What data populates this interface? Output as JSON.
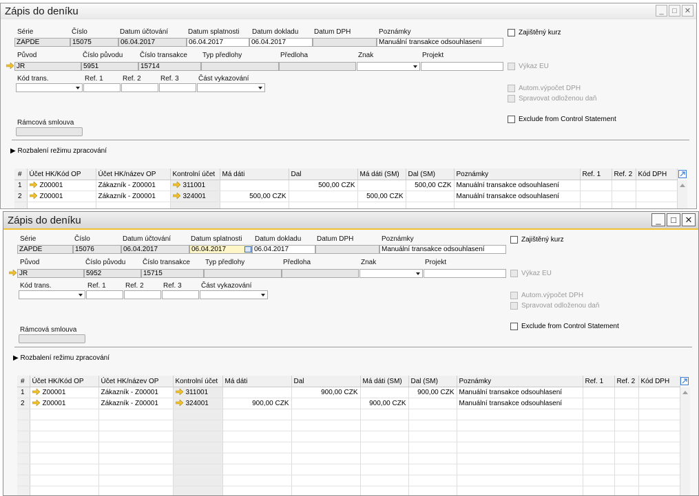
{
  "labels": {
    "serie": "Série",
    "cislo": "Číslo",
    "datum_uctovani": "Datum účtování",
    "datum_splatnosti": "Datum splatnosti",
    "datum_dokladu": "Datum dokladu",
    "datum_dph": "Datum DPH",
    "poznamky": "Poznámky",
    "puvod": "Původ",
    "cislo_puvodu": "Číslo původu",
    "cislo_transakce": "Číslo transakce",
    "typ_predlohy": "Typ předlohy",
    "predloha": "Předloha",
    "znak": "Znak",
    "projekt": "Projekt",
    "kod_trans": "Kód trans.",
    "ref1": "Ref. 1",
    "ref2": "Ref. 2",
    "ref3": "Ref. 3",
    "cast_vykazovani": "Část vykazování",
    "ramcova_smlouva": "Rámcová smlouva",
    "zajisteny_kurz": "Zajištěný kurz",
    "vykaz_eu": "Výkaz EU",
    "autom_vypocet": "Autom.výpočet DPH",
    "spravovat": "Spravovat odloženou daň",
    "exclude": "Exclude from Control Statement",
    "rozbaleni": "Rozbalení režimu zpracování"
  },
  "grid_headers": [
    "#",
    "Účet HK/Kód OP",
    "Účet HK/název OP",
    "Kontrolní účet",
    "Má dáti",
    "Dal",
    "Má dáti (SM)",
    "Dal (SM)",
    "Poznámky",
    "Ref. 1",
    "Ref. 2",
    "Kód DPH"
  ],
  "windows": {
    "back": {
      "title": "Zápis do deníku",
      "serie": "ZAPDE",
      "cislo": "15075",
      "datum_uctovani": "06.04.2017",
      "datum_splatnosti": "06.04.2017",
      "datum_dokladu": "06.04.2017",
      "poznamky": "Manuální transakce odsouhlasení",
      "puvod": "JR",
      "cislo_puvodu": "5951",
      "cislo_transakce": "15714",
      "rows": [
        {
          "n": "1",
          "ucet": "Z00001",
          "nazev": "Zákazník - Z00001",
          "kontrolni": "311001",
          "ma_dati": "",
          "dal": "500,00 CZK",
          "ma_dati_sm": "",
          "dal_sm": "500,00 CZK",
          "poznamky": "Manuální transakce odsouhlasení"
        },
        {
          "n": "2",
          "ucet": "Z00001",
          "nazev": "Zákazník - Z00001",
          "kontrolni": "324001",
          "ma_dati": "500,00 CZK",
          "dal": "",
          "ma_dati_sm": "500,00 CZK",
          "dal_sm": "",
          "poznamky": "Manuální transakce odsouhlasení"
        }
      ]
    },
    "front": {
      "title": "Zápis do deníku",
      "serie": "ZAPDE",
      "cislo": "15076",
      "datum_uctovani": "06.04.2017",
      "datum_splatnosti": "06.04.2017",
      "datum_dokladu": "06.04.2017",
      "poznamky": "Manuální transakce odsouhlasení",
      "puvod": "JR",
      "cislo_puvodu": "5952",
      "cislo_transakce": "15715",
      "rows": [
        {
          "n": "1",
          "ucet": "Z00001",
          "nazev": "Zákazník - Z00001",
          "kontrolni": "311001",
          "ma_dati": "",
          "dal": "900,00 CZK",
          "ma_dati_sm": "",
          "dal_sm": "900,00 CZK",
          "poznamky": "Manuální transakce odsouhlasení"
        },
        {
          "n": "2",
          "ucet": "Z00001",
          "nazev": "Zákazník - Z00001",
          "kontrolni": "324001",
          "ma_dati": "900,00 CZK",
          "dal": "",
          "ma_dati_sm": "900,00 CZK",
          "dal_sm": "",
          "poznamky": "Manuální transakce odsouhlasení"
        }
      ]
    }
  },
  "icons": {
    "link_arrow": "link-arrow-icon",
    "minimize": "minimize-icon",
    "maximize": "maximize-icon",
    "close": "close-icon",
    "expand": "expand-triangle-icon",
    "grid_settings": "grid-settings-icon",
    "calendar": "calendar-icon"
  },
  "colors": {
    "accent": "#f2c12e",
    "arrow": "#f2c12e",
    "field_bg": "#e6e6e6",
    "active_field": "#fff6c8"
  }
}
